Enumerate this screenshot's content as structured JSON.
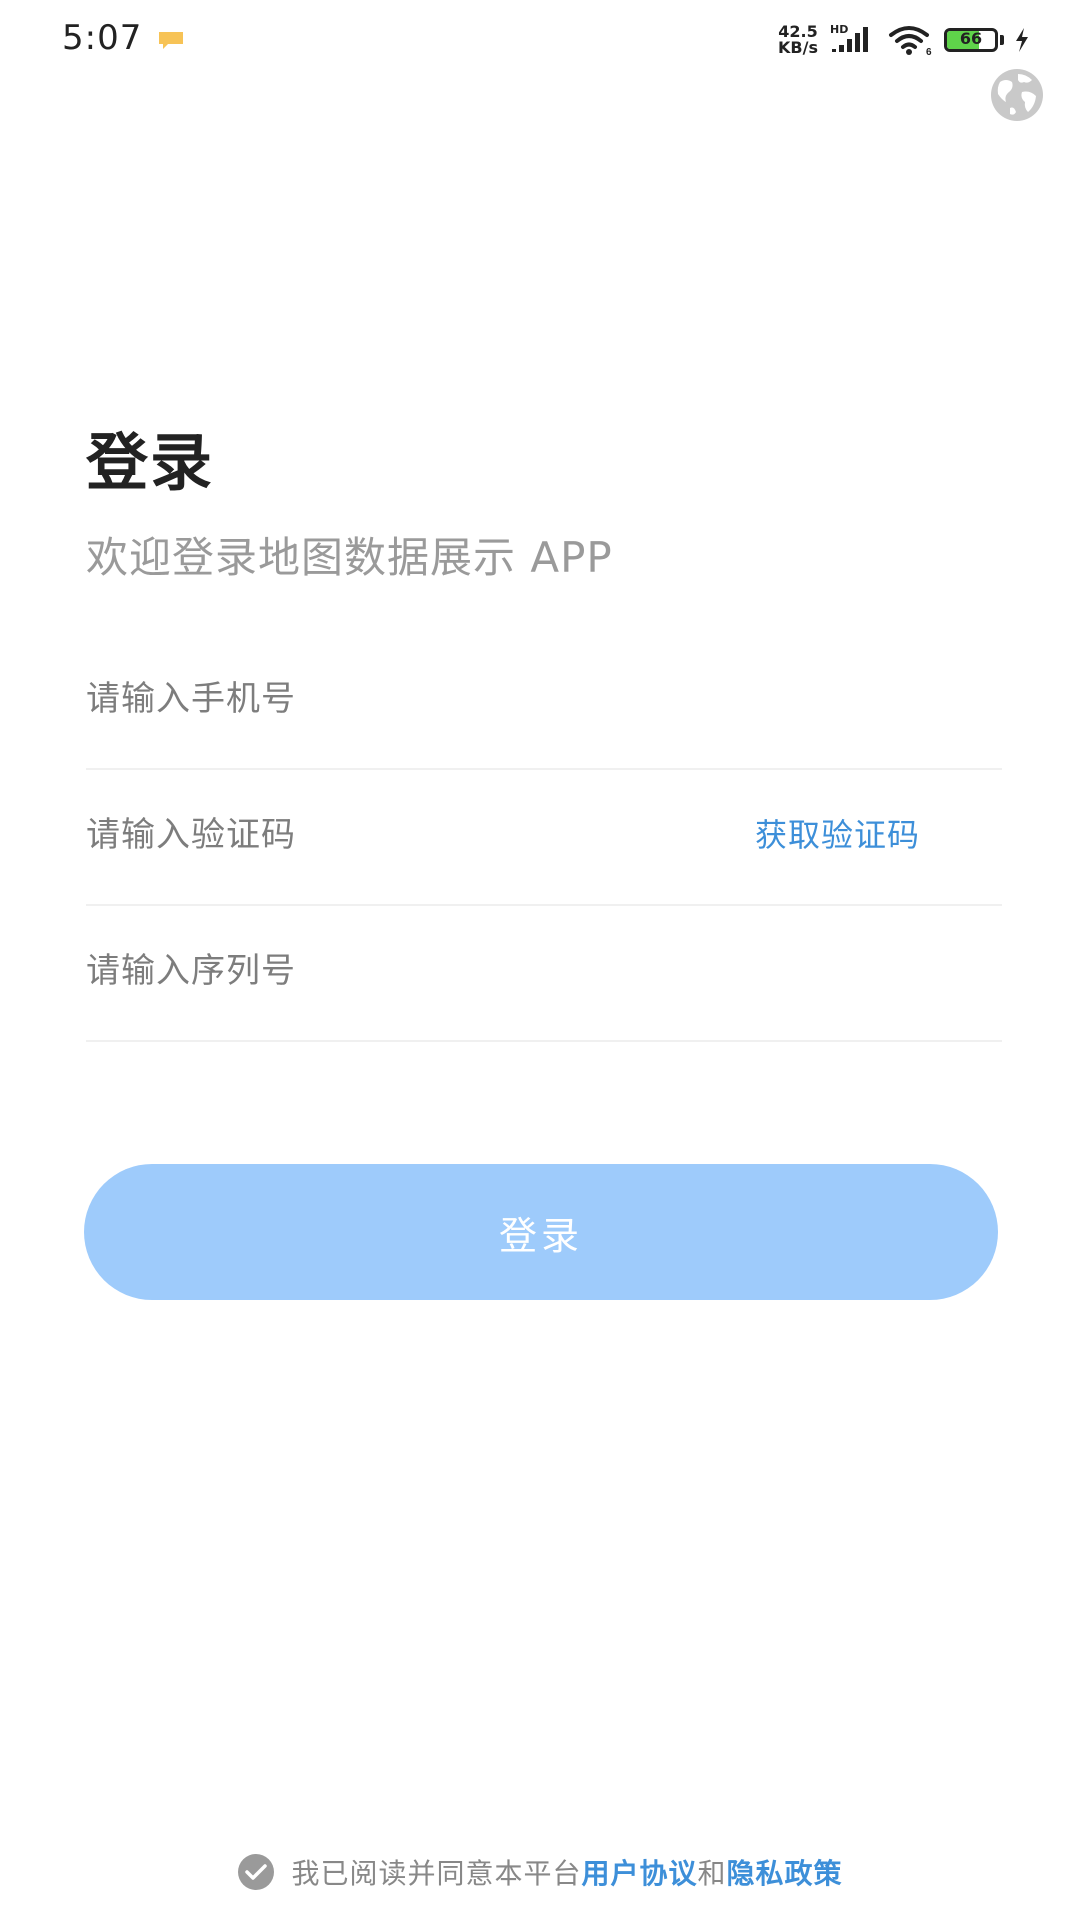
{
  "status_bar": {
    "time": "5:07",
    "net_speed_value": "42.5",
    "net_speed_unit": "KB/s",
    "network_label": "HD",
    "battery_level": "66",
    "icons": [
      "notification-icon",
      "signal-icon",
      "wifi-icon",
      "battery-icon",
      "charging-icon"
    ]
  },
  "header": {
    "globe_icon": "globe-icon"
  },
  "login": {
    "title": "登录",
    "subtitle": "欢迎登录地图数据展示 APP"
  },
  "form": {
    "phone": {
      "value": "",
      "placeholder": "请输入手机号"
    },
    "code": {
      "value": "",
      "placeholder": "请输入验证码",
      "action_label": "获取验证码"
    },
    "serial": {
      "value": "",
      "placeholder": "请输入序列号"
    },
    "submit_label": "登录"
  },
  "agreement": {
    "prefix": "我已阅读并同意本平台",
    "user_agreement": "用户协议",
    "conjunction": "和",
    "privacy_policy": "隐私政策",
    "checked": false
  },
  "colors": {
    "accent": "#3d8fd9",
    "button_bg": "#9ecbfb",
    "title": "#222222",
    "subtitle": "#9a9a9a",
    "placeholder": "#7d7d7d",
    "battery_fill": "#5fd34a"
  }
}
